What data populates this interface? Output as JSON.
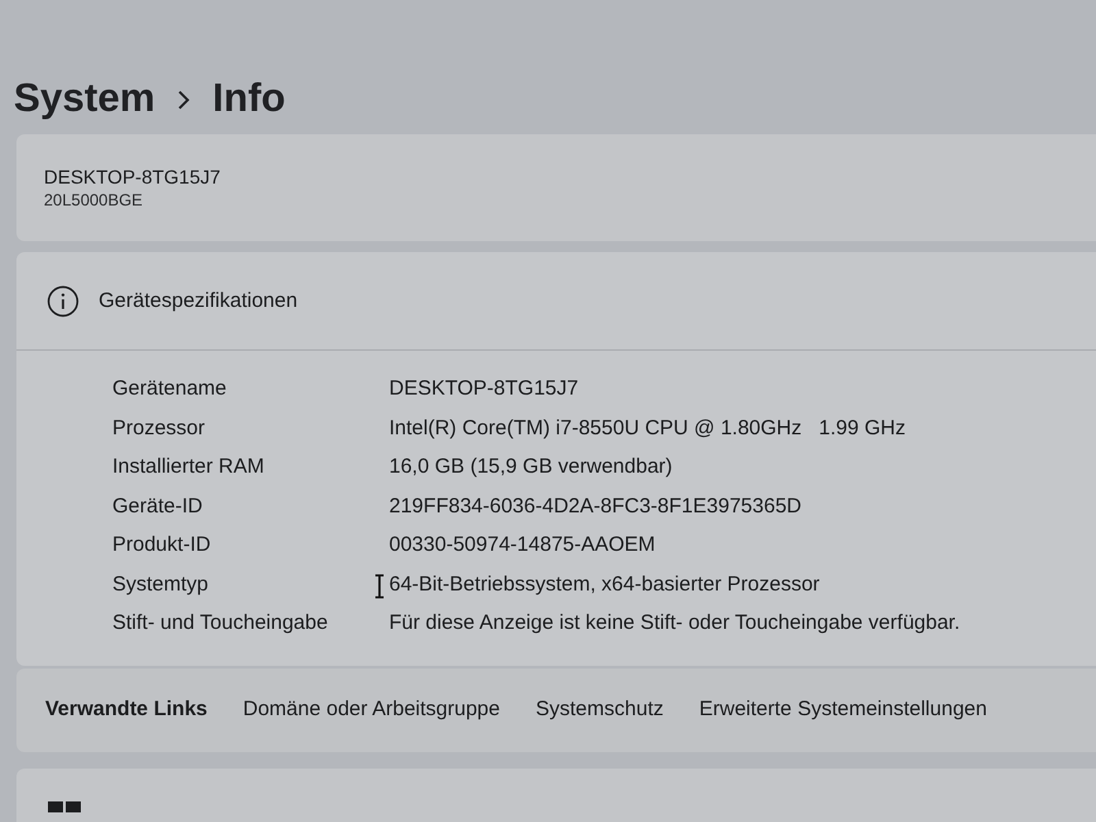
{
  "breadcrumb": {
    "parent": "System",
    "current": "Info"
  },
  "device": {
    "name": "DESKTOP-8TG15J7",
    "model": "20L5000BGE"
  },
  "specifications": {
    "title": "Gerätespezifikationen",
    "rows": [
      {
        "label": "Gerätename",
        "value": "DESKTOP-8TG15J7"
      },
      {
        "label": "Prozessor",
        "value": "Intel(R) Core(TM) i7-8550U CPU @ 1.80GHz   1.99 GHz"
      },
      {
        "label": "Installierter RAM",
        "value": "16,0 GB (15,9 GB verwendbar)"
      },
      {
        "label": "Geräte-ID",
        "value": "219FF834-6036-4D2A-8FC3-8F1E3975365D"
      },
      {
        "label": "Produkt-ID",
        "value": "00330-50974-14875-AAOEM"
      },
      {
        "label": "Systemtyp",
        "value": "64-Bit-Betriebssystem, x64-basierter Prozessor"
      },
      {
        "label": "Stift- und Toucheingabe",
        "value": "Für diese Anzeige ist keine Stift- oder Toucheingabe verfügbar."
      }
    ]
  },
  "related_links": {
    "title": "Verwandte Links",
    "links": [
      "Domäne oder Arbeitsgruppe",
      "Systemschutz",
      "Erweiterte Systemeinstellungen"
    ]
  }
}
